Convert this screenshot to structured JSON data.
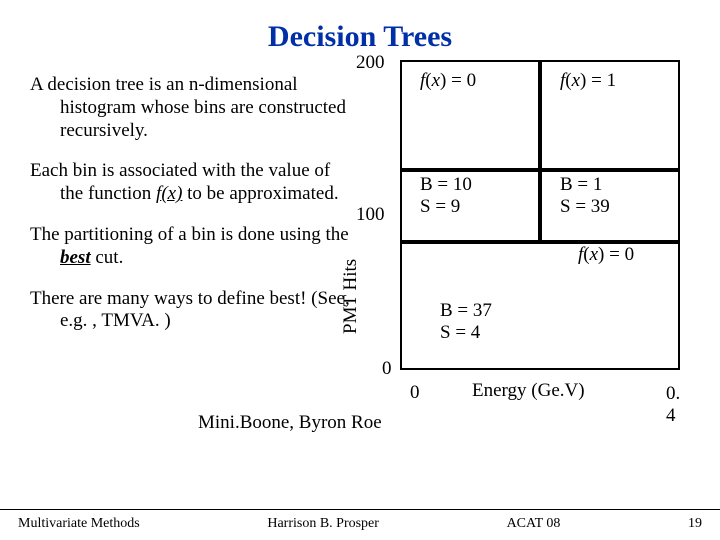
{
  "title": "Decision Trees",
  "para1_lead": "A decision tree is an",
  "para1_rest": " n-dimensional histogram whose bins are constructed recursively.",
  "para2_lead": "Each bin is associated with the ",
  "para2_mid1": "value of the function ",
  "para2_fx": "f",
  "para2_fx_tail": "(x)",
  "para2_rest": " to be approximated.",
  "para3_lead": "The partitioning of a bin is ",
  "para3_mid": "done  using the ",
  "para3_best": "best",
  "para3_rest": " cut.",
  "para4": "There are many ways to define best! (See, e.g. , TMVA. )",
  "credit": "Mini.Boone, Byron Roe",
  "footer": {
    "left": "Multivariate Methods",
    "center": "Harrison B. Prosper",
    "right": "ACAT 08",
    "page": "19"
  },
  "chart_data": {
    "type": "table",
    "title": "",
    "xlabel": "Energy (Ge.V)",
    "ylabel": "PMT Hits",
    "xlim": [
      0,
      0.4
    ],
    "ylim": [
      0,
      200
    ],
    "xticks": [
      0,
      0.4
    ],
    "yticks": [
      0,
      100,
      200
    ],
    "cells": [
      {
        "x": [
          0,
          0.2
        ],
        "y": [
          100,
          200
        ],
        "label": "f(x) = 0",
        "B": null,
        "S": null
      },
      {
        "x": [
          0.2,
          0.4
        ],
        "y": [
          100,
          200
        ],
        "label": "f(x) = 1",
        "B": null,
        "S": null
      },
      {
        "x": [
          0,
          0.2
        ],
        "y": [
          60,
          100
        ],
        "label": null,
        "B": 10,
        "S": 9
      },
      {
        "x": [
          0.2,
          0.4
        ],
        "y": [
          60,
          100
        ],
        "label": "f(x) = 0",
        "B": 1,
        "S": 39
      },
      {
        "x": [
          0,
          0.4
        ],
        "y": [
          0,
          60
        ],
        "label": null,
        "B": 37,
        "S": 4
      }
    ],
    "strings": {
      "tick200": "200",
      "tick100": "100",
      "tick0": "0",
      "tick04": "0. 4",
      "fx0": "f(x) = 0",
      "fx1": "f(x) = 1",
      "b10": "B = 10",
      "s9": "S = 9",
      "b1": "B =  1",
      "s39": "S = 39",
      "b37": "B = 37",
      "s4": "S = 4"
    }
  }
}
